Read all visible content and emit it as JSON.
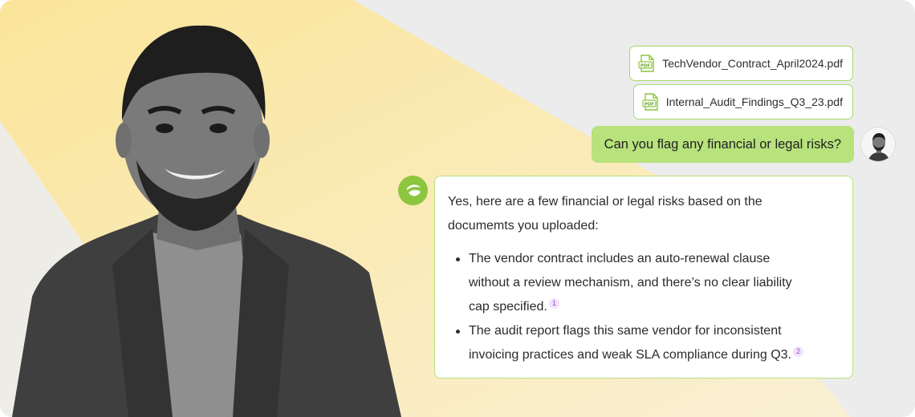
{
  "attachments": [
    {
      "name": "TechVendor_Contract_April2024.pdf",
      "icon": "pdf-file-icon",
      "icon_text": "PDF"
    },
    {
      "name": "Internal_Audit_Findings_Q3_23.pdf",
      "icon": "pdf-file-icon",
      "icon_text": "PDF"
    }
  ],
  "user_message": {
    "text": "Can you flag any financial or legal risks?"
  },
  "assistant_message": {
    "intro_line1": "Yes, here are a few financial or legal risks based on the",
    "intro_line2": "documemts you uploaded:",
    "bullets": [
      {
        "lines": [
          "The vendor contract includes an auto-renewal clause",
          "without a review mechanism, and there’s no clear liability",
          "cap specified."
        ],
        "citation": "1"
      },
      {
        "lines": [
          "The audit report flags this same vendor for inconsistent",
          "invoicing practices and weak SLA compliance during Q3."
        ],
        "citation": "2"
      }
    ]
  },
  "colors": {
    "accent_green": "#8cc63f",
    "bubble_green": "#b7e27c",
    "citation_purple": "#a04ad6",
    "background_yellow": "#f8e7a6"
  }
}
